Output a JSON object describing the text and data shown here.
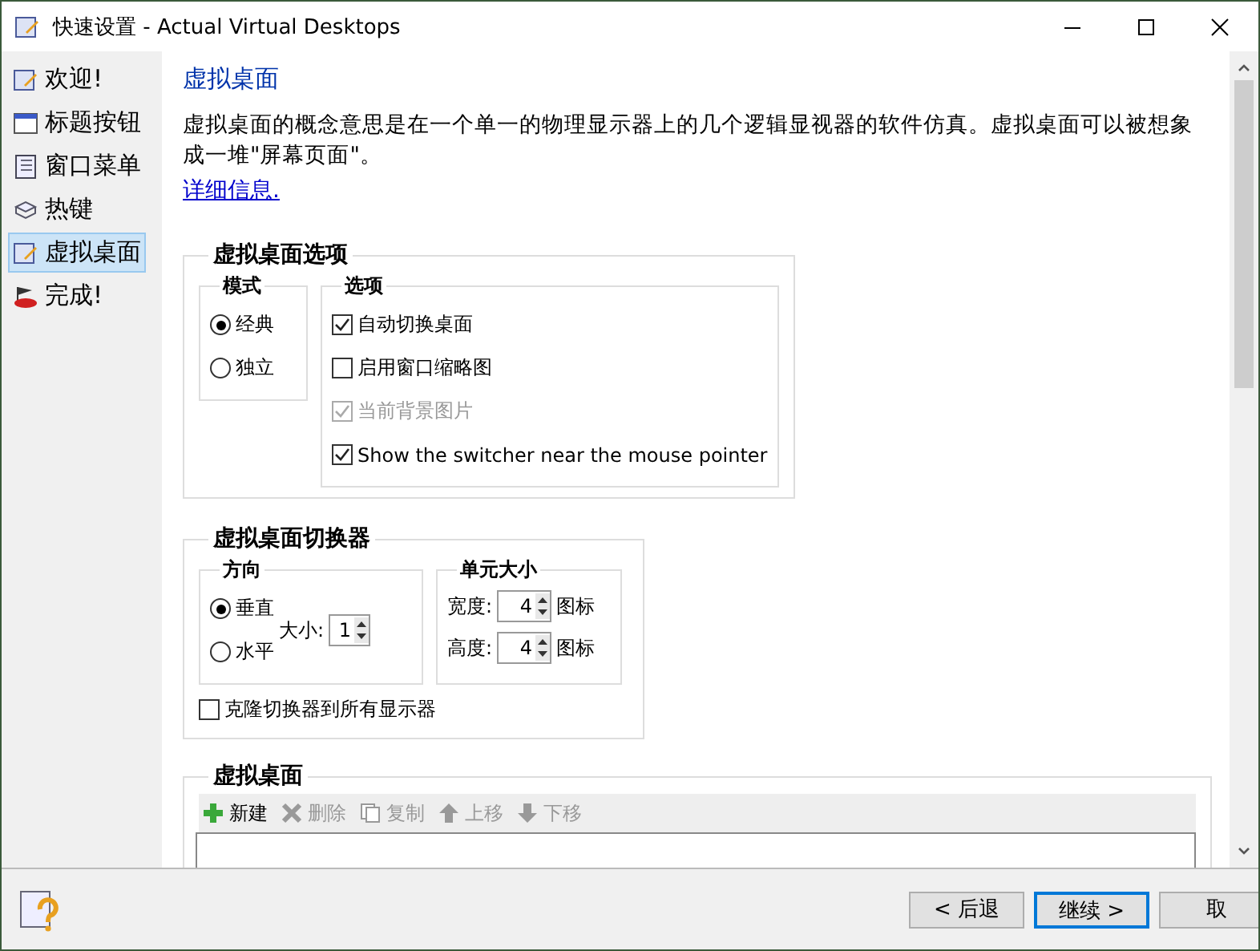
{
  "window": {
    "title": "快速设置 - Actual Virtual Desktops"
  },
  "sidebar": {
    "items": [
      {
        "label": "欢迎!",
        "selected": false
      },
      {
        "label": "标题按钮",
        "selected": false
      },
      {
        "label": "窗口菜单",
        "selected": false
      },
      {
        "label": "热键",
        "selected": false
      },
      {
        "label": "虚拟桌面",
        "selected": true
      },
      {
        "label": "完成!",
        "selected": false
      }
    ]
  },
  "page": {
    "heading": "虚拟桌面",
    "description": "虚拟桌面的概念意思是在一个单一的物理显示器上的几个逻辑显视器的软件仿真。虚拟桌面可以被想象成一堆\"屏幕页面\"。",
    "link": "详细信息."
  },
  "options_group": {
    "title": "虚拟桌面选项",
    "mode": {
      "title": "模式",
      "radios": [
        {
          "label": "经典",
          "selected": true
        },
        {
          "label": "独立",
          "selected": false
        }
      ]
    },
    "options": {
      "title": "选项",
      "checkboxes": [
        {
          "label": "自动切换桌面",
          "checked": true,
          "disabled": false
        },
        {
          "label": "启用窗口缩略图",
          "checked": false,
          "disabled": false
        },
        {
          "label": "当前背景图片",
          "checked": true,
          "disabled": true
        },
        {
          "label": "Show the switcher near the mouse pointer",
          "checked": true,
          "disabled": false
        }
      ]
    }
  },
  "switcher_group": {
    "title": "虚拟桌面切换器",
    "direction": {
      "title": "方向",
      "radios": [
        {
          "label": "垂直",
          "selected": true
        },
        {
          "label": "水平",
          "selected": false
        }
      ],
      "size_label": "大小:",
      "size_value": "1"
    },
    "cell_size": {
      "title": "单元大小",
      "rows": [
        {
          "label": "宽度:",
          "value": "4",
          "unit": "图标"
        },
        {
          "label": "高度:",
          "value": "4",
          "unit": "图标"
        }
      ]
    },
    "clone": {
      "label": "克隆切换器到所有显示器",
      "checked": false
    }
  },
  "desktops_group": {
    "title": "虚拟桌面",
    "toolbar": [
      {
        "label": "新建",
        "disabled": false
      },
      {
        "label": "删除",
        "disabled": true
      },
      {
        "label": "复制",
        "disabled": true
      },
      {
        "label": "上移",
        "disabled": true
      },
      {
        "label": "下移",
        "disabled": true
      }
    ]
  },
  "footer": {
    "buttons": [
      {
        "label": "< 后退",
        "default": false
      },
      {
        "label": "继续 >",
        "default": true
      },
      {
        "label": "取",
        "default": false
      }
    ]
  }
}
